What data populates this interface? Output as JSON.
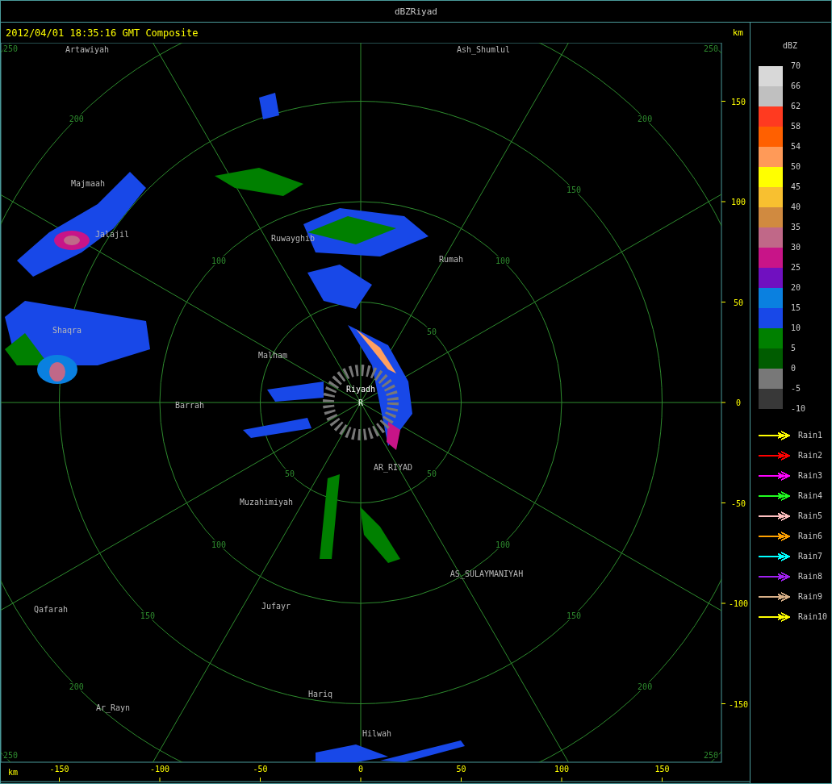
{
  "window": {
    "title": "dBZRiyad"
  },
  "header": {
    "timestamp": "2012/04/01 18:35:16 GMT Composite",
    "unit": "km"
  },
  "map": {
    "center_marker": "R",
    "rings": [
      {
        "labels": [
          "50",
          "50",
          "50"
        ]
      },
      {
        "labels": [
          "100",
          "100",
          "100",
          "100"
        ]
      },
      {
        "labels": [
          "150",
          "150",
          "150"
        ]
      },
      {
        "labels": [
          "200",
          "200",
          "200",
          "200"
        ]
      },
      {
        "labels": [
          "250",
          "250",
          "250",
          "250"
        ]
      }
    ],
    "places": [
      {
        "name": "Artawiyah",
        "kind": "town"
      },
      {
        "name": "Ash_Shumlul",
        "kind": "town"
      },
      {
        "name": "Majmaah",
        "kind": "town"
      },
      {
        "name": "Jalajil",
        "kind": "town"
      },
      {
        "name": "Ruwayghib",
        "kind": "town"
      },
      {
        "name": "Rumah",
        "kind": "town"
      },
      {
        "name": "Shaqra",
        "kind": "town"
      },
      {
        "name": "Malham",
        "kind": "town"
      },
      {
        "name": "Riyadh",
        "kind": "site"
      },
      {
        "name": "Barrah",
        "kind": "town"
      },
      {
        "name": "AR_RIYAD",
        "kind": "town"
      },
      {
        "name": "Muzahimiyah",
        "kind": "town"
      },
      {
        "name": "AS_SULAYMANIYAH",
        "kind": "town"
      },
      {
        "name": "Qafarah",
        "kind": "town"
      },
      {
        "name": "Jufayr",
        "kind": "town"
      },
      {
        "name": "Hariq",
        "kind": "town"
      },
      {
        "name": "Ar_Rayn",
        "kind": "town"
      },
      {
        "name": "Hilwah",
        "kind": "town"
      }
    ]
  },
  "y_axis": {
    "ticks": [
      "150",
      "100",
      "50",
      "0",
      "-50",
      "-100",
      "-150"
    ]
  },
  "x_axis": {
    "unit": "km",
    "ticks": [
      "-150",
      "-100",
      "-50",
      "0",
      "50",
      "100",
      "150"
    ]
  },
  "legend": {
    "title": "dBZ",
    "scale_labels": [
      "70",
      "66",
      "62",
      "58",
      "54",
      "50",
      "45",
      "40",
      "35",
      "30",
      "25",
      "20",
      "15",
      "10",
      "5",
      "0",
      "-5",
      "-10"
    ],
    "bands": [
      {
        "color": "#d8d8d8"
      },
      {
        "color": "#c0c0c0"
      },
      {
        "color": "#ff3a20"
      },
      {
        "color": "#ff6000"
      },
      {
        "color": "#ff9a58"
      },
      {
        "color": "#ffff00"
      },
      {
        "color": "#f8c030"
      },
      {
        "color": "#d08a40"
      },
      {
        "color": "#c06888"
      },
      {
        "color": "#c81488"
      },
      {
        "color": "#7010c0"
      },
      {
        "color": "#0a80e0"
      },
      {
        "color": "#1848e8"
      },
      {
        "color": "#008000"
      },
      {
        "color": "#005c00"
      },
      {
        "color": "#787878"
      },
      {
        "color": "#383838"
      }
    ],
    "tracks": [
      {
        "label": "Rain1",
        "color": "#ffff00"
      },
      {
        "label": "Rain2",
        "color": "#ff0000"
      },
      {
        "label": "Rain3",
        "color": "#ff00ff"
      },
      {
        "label": "Rain4",
        "color": "#20ff20"
      },
      {
        "label": "Rain5",
        "color": "#ffc0c0"
      },
      {
        "label": "Rain6",
        "color": "#ffa000"
      },
      {
        "label": "Rain7",
        "color": "#00ffff"
      },
      {
        "label": "Rain8",
        "color": "#a020f0"
      },
      {
        "label": "Rain9",
        "color": "#d8b088"
      },
      {
        "label": "Rain10",
        "color": "#ffff00"
      }
    ]
  }
}
